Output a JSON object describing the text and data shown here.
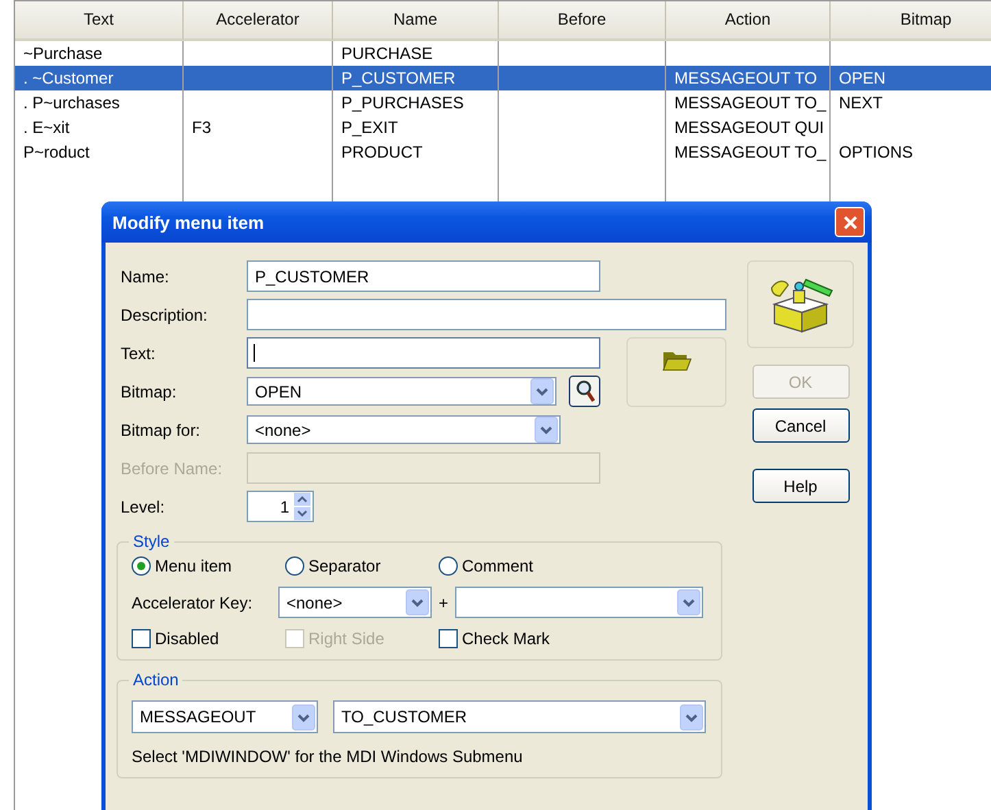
{
  "table": {
    "columns": [
      "Text",
      "Accelerator",
      "Name",
      "Before",
      "Action",
      "Bitmap"
    ],
    "rows": [
      {
        "cells": [
          "~Purchase",
          "",
          "PURCHASE",
          "",
          "",
          ""
        ],
        "selected": false
      },
      {
        "cells": [
          " .  ~Customer",
          "",
          "P_CUSTOMER",
          "",
          "MESSAGEOUT TO",
          "OPEN"
        ],
        "selected": true
      },
      {
        "cells": [
          " .  P~urchases",
          "",
          "P_PURCHASES",
          "",
          "MESSAGEOUT TO_",
          "NEXT"
        ],
        "selected": false
      },
      {
        "cells": [
          " .  E~xit",
          "F3",
          "P_EXIT",
          "",
          "MESSAGEOUT QUI",
          ""
        ],
        "selected": false
      },
      {
        "cells": [
          "P~roduct",
          "",
          "PRODUCT",
          "",
          "MESSAGEOUT TO_",
          "OPTIONS"
        ],
        "selected": false
      }
    ]
  },
  "dialog": {
    "title": "Modify menu item",
    "fields": [
      {
        "kind": "text",
        "label": "Name:",
        "value": "P_CUSTOMER",
        "disabled": false
      },
      {
        "kind": "wide",
        "label": "Description:",
        "disabled": false
      },
      {
        "kind": "text",
        "label": "Text:",
        "disabled": false,
        "focused": true
      },
      {
        "kind": "combo_search",
        "label": "Bitmap:",
        "value": "OPEN",
        "disabled": false
      },
      {
        "kind": "combo",
        "label": "Bitmap for:",
        "value": "<none>",
        "disabled": false
      },
      {
        "kind": "text",
        "label": "Before Name:",
        "disabled": true
      },
      {
        "kind": "spin",
        "label": "Level:",
        "value": "1",
        "disabled": false
      }
    ],
    "buttons": [
      {
        "label": "OK",
        "disabled": true
      },
      {
        "label": "Cancel",
        "disabled": false
      },
      {
        "label": "Help",
        "disabled": false
      }
    ],
    "style": {
      "title": "Style",
      "radios": [
        {
          "label": "Menu item",
          "selected": true
        },
        {
          "label": "Separator",
          "selected": false
        },
        {
          "label": "Comment",
          "selected": false
        }
      ],
      "accelerator": {
        "label": "Accelerator Key:",
        "key": "<none>",
        "plus": "+"
      },
      "checkboxes": [
        {
          "label": "Disabled",
          "checked": false,
          "disabled": false
        },
        {
          "label": "Right Side",
          "checked": false,
          "disabled": true
        },
        {
          "label": "Check Mark",
          "checked": false,
          "disabled": false
        }
      ]
    },
    "action": {
      "title": "Action",
      "type": "MESSAGEOUT",
      "target": "TO_CUSTOMER",
      "hint": "Select 'MDIWINDOW' for the MDI Windows Submenu"
    }
  }
}
